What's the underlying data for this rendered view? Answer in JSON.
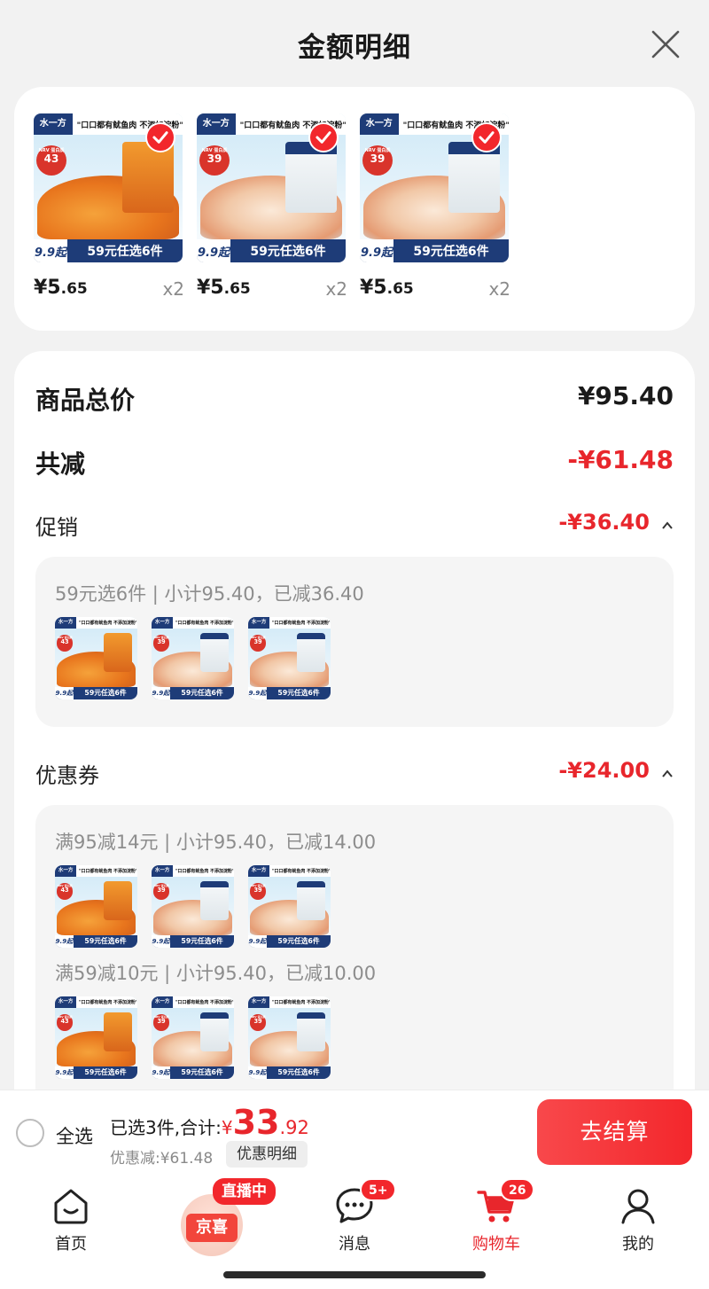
{
  "header": {
    "title": "金额明细",
    "close": "close"
  },
  "products": [
    {
      "brand": "水一方",
      "tagline": "\"口口都有鱿鱼肉 不添加淀粉\"",
      "nrv_label": "NRV 蛋白质",
      "nrv_value": "43",
      "ref_price": "9.9起",
      "promo": "59元任选6件",
      "price_int": "¥5",
      "price_dec": ".65",
      "qty": "x2",
      "selected": true,
      "variant": "orange"
    },
    {
      "brand": "水一方",
      "tagline": "\"口口都有鱿鱼肉 不添加淀粉\"",
      "nrv_label": "NRV 蛋白质",
      "nrv_value": "39",
      "ref_price": "9.9起",
      "promo": "59元任选6件",
      "price_int": "¥5",
      "price_dec": ".65",
      "qty": "x2",
      "selected": true,
      "variant": "white"
    },
    {
      "brand": "水一方",
      "tagline": "\"口口都有鱿鱼肉 不添加淀粉\"",
      "nrv_label": "NRV 蛋白质",
      "nrv_value": "39",
      "ref_price": "9.9起",
      "promo": "59元任选6件",
      "price_int": "¥5",
      "price_dec": ".65",
      "qty": "x2",
      "selected": true,
      "variant": "white"
    }
  ],
  "summary": {
    "goods_total_label": "商品总价",
    "goods_total_value": "¥95.40",
    "total_discount_label": "共减",
    "total_discount_value": "-¥61.48"
  },
  "promotion": {
    "label": "促销",
    "value": "-¥36.40",
    "groups": [
      {
        "title": "59元选6件 | 小计95.40，已减36.40"
      }
    ]
  },
  "coupon": {
    "label": "优惠券",
    "value": "-¥24.00",
    "groups": [
      {
        "title": "满95减14元 | 小计95.40，已减14.00"
      },
      {
        "title": "满59减10元 | 小计95.40，已减10.00"
      }
    ]
  },
  "checkout": {
    "select_all": "全选",
    "selected_text": "已选3件,合计:",
    "currency": "¥",
    "total_int": "33",
    "total_dec": ".92",
    "saved_text": "优惠减:¥61.48",
    "detail_button": "优惠明细",
    "pay_button": "去结算"
  },
  "tabbar": {
    "items": [
      {
        "label": "首页",
        "icon": "home-icon"
      },
      {
        "label": "",
        "icon": "jingxi-logo",
        "badge": "直播中",
        "logo_text": "京喜"
      },
      {
        "label": "消息",
        "icon": "message-icon",
        "badge": "5+"
      },
      {
        "label": "购物车",
        "icon": "cart-icon",
        "badge": "26",
        "active": true
      },
      {
        "label": "我的",
        "icon": "user-icon"
      }
    ]
  },
  "colors": {
    "accent": "#e8262c",
    "brand_blue": "#1e3c78",
    "background": "#f2f2f2"
  }
}
